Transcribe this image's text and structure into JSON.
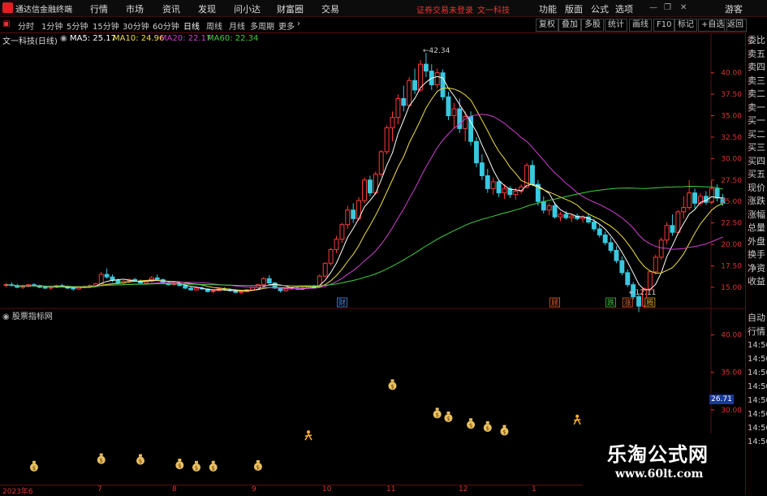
{
  "titlebar": {
    "app_name": "通达信金融终端",
    "menus": [
      "行情",
      "市场",
      "资讯",
      "发现",
      "问小达",
      "财富圈",
      "交易"
    ],
    "notice": "证券交易未登录",
    "stock": "文一科技",
    "right_menus": [
      "功能",
      "版面",
      "公式",
      "选项"
    ],
    "user": "游客"
  },
  "toolbar": {
    "periods": [
      "分时",
      "1分钟",
      "5分钟",
      "15分钟",
      "30分钟",
      "60分钟",
      "日线",
      "周线",
      "月线",
      "多周期",
      "更多"
    ],
    "active_period": "日线",
    "right_buttons": [
      "复权",
      "叠加",
      "多股",
      "统计",
      "画线",
      "F10",
      "标记",
      "+自选",
      "返回"
    ]
  },
  "info": {
    "title": "文一科技(日线)",
    "ma5_label": "MA5: 25.17",
    "ma10_label": "MA10: 24.96",
    "ma20_label": "MA20: 22.17",
    "ma60_label": "MA60: 22.34",
    "colors": {
      "ma5": "#ffffff",
      "ma10": "#f0e040",
      "ma20": "#d040d0",
      "ma60": "#40d040"
    }
  },
  "right_panel": {
    "items_top": [
      "委比",
      "卖五",
      "卖四",
      "卖三",
      "卖二",
      "卖一",
      "买一",
      "买二",
      "买三",
      "买四",
      "买五",
      "现价",
      "涨跌",
      "涨幅",
      "总量",
      "外盘",
      "换手",
      "净资",
      "收益"
    ],
    "items_bottom": [
      "自动",
      "行情",
      "14:50",
      "14:50",
      "14:50",
      "14:50",
      "14:50",
      "14:50",
      "14:50",
      "14:50"
    ]
  },
  "indicator": {
    "title": "股票指标网",
    "current_price": "26.71"
  },
  "chart_data": {
    "type": "candlestick",
    "y_ticks": [
      "40.00",
      "37.50",
      "35.00",
      "32.50",
      "30.00",
      "27.50",
      "25.00",
      "22.50",
      "20.00",
      "17.50",
      "15.00"
    ],
    "y_range": [
      13.0,
      43.0
    ],
    "sub_y_ticks": [
      "40.00",
      "35.00",
      "30.00",
      "25.00"
    ],
    "annotations": {
      "high": "42.34",
      "low": "12.11"
    },
    "markers": [
      "财",
      "顾",
      "跌",
      "涨",
      "腾"
    ],
    "x_labels": [
      "2023年6",
      "7",
      "8",
      "9",
      "10",
      "11",
      "12",
      "1"
    ],
    "candles": [
      [
        15.2,
        15.5,
        15.0,
        15.3
      ],
      [
        15.3,
        15.6,
        15.1,
        15.2
      ],
      [
        15.2,
        15.4,
        14.9,
        15.0
      ],
      [
        15.0,
        15.3,
        14.8,
        15.1
      ],
      [
        15.1,
        15.4,
        15.0,
        15.3
      ],
      [
        15.3,
        15.5,
        15.1,
        15.2
      ],
      [
        15.2,
        15.3,
        14.9,
        15.0
      ],
      [
        15.0,
        15.2,
        14.8,
        14.9
      ],
      [
        14.9,
        15.1,
        14.7,
        15.0
      ],
      [
        15.0,
        15.3,
        14.9,
        15.2
      ],
      [
        15.2,
        15.4,
        15.0,
        15.1
      ],
      [
        15.1,
        15.2,
        14.8,
        14.9
      ],
      [
        14.9,
        15.0,
        14.6,
        14.8
      ],
      [
        14.8,
        15.1,
        14.7,
        15.0
      ],
      [
        15.0,
        15.2,
        14.9,
        15.1
      ],
      [
        15.1,
        15.3,
        15.0,
        15.2
      ],
      [
        15.2,
        15.5,
        15.1,
        15.4
      ],
      [
        15.4,
        16.8,
        15.3,
        16.5
      ],
      [
        16.5,
        17.2,
        16.0,
        16.2
      ],
      [
        16.2,
        16.5,
        15.6,
        15.8
      ],
      [
        15.8,
        16.0,
        15.4,
        15.5
      ],
      [
        15.5,
        15.8,
        15.3,
        15.7
      ],
      [
        15.7,
        16.0,
        15.5,
        15.9
      ],
      [
        15.9,
        16.1,
        15.6,
        15.7
      ],
      [
        15.7,
        15.9,
        15.4,
        15.5
      ],
      [
        15.5,
        15.8,
        15.4,
        15.7
      ],
      [
        15.7,
        16.3,
        15.6,
        16.1
      ],
      [
        16.1,
        16.5,
        15.8,
        15.9
      ],
      [
        15.9,
        16.0,
        15.4,
        15.5
      ],
      [
        15.5,
        15.7,
        15.2,
        15.3
      ],
      [
        15.3,
        15.6,
        15.2,
        15.4
      ],
      [
        15.4,
        15.6,
        15.1,
        15.2
      ],
      [
        15.2,
        15.3,
        14.8,
        14.9
      ],
      [
        14.9,
        15.1,
        14.6,
        14.7
      ],
      [
        14.7,
        15.0,
        14.6,
        14.9
      ],
      [
        14.9,
        15.1,
        14.7,
        14.8
      ],
      [
        14.8,
        14.9,
        14.4,
        14.5
      ],
      [
        14.5,
        14.7,
        14.3,
        14.6
      ],
      [
        14.6,
        14.9,
        14.5,
        14.8
      ],
      [
        14.8,
        15.0,
        14.6,
        14.7
      ],
      [
        14.7,
        14.9,
        14.5,
        14.6
      ],
      [
        14.6,
        14.8,
        14.3,
        14.4
      ],
      [
        14.4,
        14.6,
        14.2,
        14.5
      ],
      [
        14.5,
        14.8,
        14.4,
        14.7
      ],
      [
        14.7,
        15.1,
        14.6,
        15.0
      ],
      [
        15.0,
        15.4,
        14.9,
        15.3
      ],
      [
        15.3,
        16.2,
        15.2,
        16.0
      ],
      [
        16.0,
        16.4,
        15.4,
        15.5
      ],
      [
        15.5,
        15.6,
        14.8,
        14.9
      ],
      [
        14.9,
        15.0,
        14.4,
        14.6
      ],
      [
        14.6,
        14.9,
        14.5,
        14.8
      ],
      [
        14.8,
        15.0,
        14.7,
        14.9
      ],
      [
        14.9,
        15.1,
        14.7,
        14.8
      ],
      [
        14.8,
        15.0,
        14.7,
        14.9
      ],
      [
        14.9,
        15.2,
        14.8,
        15.1
      ],
      [
        15.1,
        15.3,
        14.9,
        15.0
      ],
      [
        15.0,
        16.5,
        14.9,
        16.3
      ],
      [
        16.3,
        17.9,
        16.1,
        17.8
      ],
      [
        17.8,
        19.6,
        17.5,
        19.4
      ],
      [
        19.4,
        21.0,
        19.0,
        20.6
      ],
      [
        20.6,
        22.5,
        20.2,
        22.3
      ],
      [
        22.3,
        24.5,
        21.8,
        24.0
      ],
      [
        24.0,
        24.8,
        22.5,
        23.0
      ],
      [
        23.0,
        25.5,
        22.8,
        25.1
      ],
      [
        25.1,
        27.8,
        24.8,
        27.5
      ],
      [
        27.5,
        28.0,
        25.6,
        26.0
      ],
      [
        26.0,
        28.5,
        25.8,
        28.2
      ],
      [
        28.2,
        31.0,
        27.9,
        30.8
      ],
      [
        30.8,
        33.9,
        30.5,
        33.6
      ],
      [
        33.6,
        35.5,
        32.0,
        34.8
      ],
      [
        34.8,
        37.5,
        34.0,
        37.0
      ],
      [
        37.0,
        38.5,
        35.5,
        36.2
      ],
      [
        36.2,
        39.5,
        36.0,
        39.1
      ],
      [
        39.1,
        40.5,
        37.5,
        38.0
      ],
      [
        38.0,
        41.5,
        37.8,
        41.0
      ],
      [
        41.0,
        42.34,
        39.5,
        40.2
      ],
      [
        40.2,
        41.0,
        38.0,
        38.6
      ],
      [
        38.6,
        40.5,
        38.2,
        40.0
      ],
      [
        40.0,
        40.4,
        36.8,
        37.2
      ],
      [
        37.2,
        37.8,
        34.5,
        35.0
      ],
      [
        35.0,
        36.5,
        33.5,
        35.8
      ],
      [
        35.8,
        37.0,
        33.0,
        33.5
      ],
      [
        33.5,
        35.5,
        32.0,
        34.9
      ],
      [
        34.9,
        35.5,
        31.5,
        32.0
      ],
      [
        32.0,
        32.5,
        29.0,
        29.5
      ],
      [
        29.5,
        30.5,
        27.5,
        28.0
      ],
      [
        28.0,
        28.8,
        26.0,
        26.5
      ],
      [
        26.5,
        27.8,
        25.8,
        27.3
      ],
      [
        27.3,
        27.5,
        25.5,
        26.0
      ],
      [
        26.0,
        27.0,
        25.3,
        26.5
      ],
      [
        26.5,
        26.8,
        25.4,
        25.8
      ],
      [
        25.8,
        26.6,
        25.2,
        26.2
      ],
      [
        26.2,
        27.0,
        25.9,
        26.7
      ],
      [
        26.7,
        29.5,
        26.5,
        29.2
      ],
      [
        29.2,
        29.8,
        26.8,
        27.0
      ],
      [
        27.0,
        27.5,
        24.5,
        25.0
      ],
      [
        25.0,
        25.6,
        23.6,
        24.0
      ],
      [
        24.0,
        24.8,
        23.4,
        24.5
      ],
      [
        24.5,
        24.9,
        23.0,
        23.2
      ],
      [
        23.2,
        23.8,
        22.7,
        23.5
      ],
      [
        23.5,
        23.9,
        22.9,
        23.1
      ],
      [
        23.1,
        23.5,
        22.6,
        23.3
      ],
      [
        23.3,
        23.6,
        22.8,
        23.0
      ],
      [
        23.0,
        23.4,
        22.5,
        23.2
      ],
      [
        23.2,
        23.6,
        22.4,
        22.6
      ],
      [
        22.6,
        23.0,
        21.5,
        21.8
      ],
      [
        21.8,
        22.3,
        20.8,
        21.1
      ],
      [
        21.1,
        21.5,
        19.9,
        20.2
      ],
      [
        20.2,
        20.8,
        19.0,
        19.3
      ],
      [
        19.3,
        19.8,
        17.8,
        18.1
      ],
      [
        18.1,
        18.6,
        16.4,
        16.7
      ],
      [
        16.7,
        17.1,
        15.0,
        15.3
      ],
      [
        15.3,
        15.6,
        13.6,
        13.9
      ],
      [
        13.9,
        14.3,
        12.11,
        12.8
      ],
      [
        12.8,
        15.0,
        12.6,
        14.8
      ],
      [
        14.8,
        17.0,
        14.5,
        16.8
      ],
      [
        16.8,
        18.8,
        16.5,
        18.5
      ],
      [
        18.5,
        20.8,
        18.2,
        20.5
      ],
      [
        20.5,
        22.6,
        20.0,
        22.2
      ],
      [
        22.2,
        23.5,
        21.0,
        21.4
      ],
      [
        21.4,
        24.0,
        21.2,
        23.8
      ],
      [
        23.8,
        25.6,
        23.0,
        24.3
      ],
      [
        24.3,
        27.5,
        24.0,
        26.0
      ],
      [
        26.0,
        26.5,
        24.2,
        24.8
      ],
      [
        24.8,
        26.0,
        24.5,
        25.6
      ],
      [
        25.6,
        26.2,
        24.6,
        24.9
      ],
      [
        24.9,
        27.4,
        24.7,
        26.5
      ],
      [
        26.5,
        27.0,
        25.0,
        25.4
      ],
      [
        25.4,
        25.9,
        24.5,
        24.8
      ]
    ],
    "indicator_points": [
      {
        "index": 5,
        "value": 22.3,
        "type": "bag"
      },
      {
        "index": 17,
        "value": 23.3,
        "type": "bag"
      },
      {
        "index": 24,
        "value": 23.2,
        "type": "bag"
      },
      {
        "index": 31,
        "value": 22.6,
        "type": "bag"
      },
      {
        "index": 34,
        "value": 22.3,
        "type": "bag"
      },
      {
        "index": 37,
        "value": 22.3,
        "type": "bag"
      },
      {
        "index": 45,
        "value": 22.4,
        "type": "bag"
      },
      {
        "index": 54,
        "value": 26.5,
        "type": "person"
      },
      {
        "index": 69,
        "value": 33.2,
        "type": "bag"
      },
      {
        "index": 77,
        "value": 29.4,
        "type": "bag"
      },
      {
        "index": 79,
        "value": 28.9,
        "type": "bag"
      },
      {
        "index": 83,
        "value": 28.0,
        "type": "bag"
      },
      {
        "index": 86,
        "value": 27.6,
        "type": "bag"
      },
      {
        "index": 89,
        "value": 27.1,
        "type": "bag"
      },
      {
        "index": 102,
        "value": 28.6,
        "type": "person"
      }
    ]
  }
}
